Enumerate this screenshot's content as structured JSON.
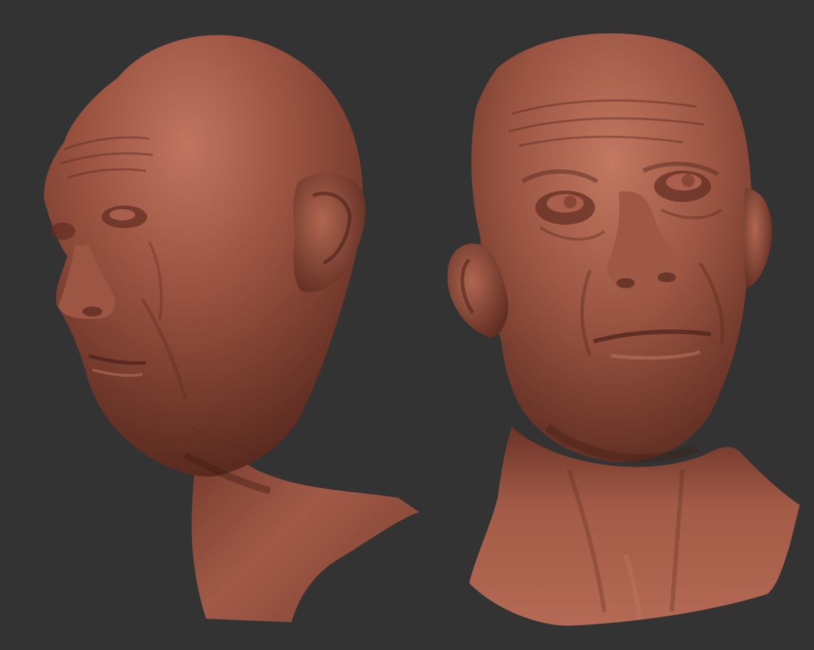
{
  "scene": {
    "background_color": "#333333",
    "material_color": "#8a4a38",
    "material_highlight": "#b9705a",
    "material_shadow": "#4a2119",
    "subjects": [
      {
        "name": "left-head-bust",
        "view": "three-quarter-left"
      },
      {
        "name": "right-head-bust",
        "view": "three-quarter-front-upward"
      }
    ]
  }
}
